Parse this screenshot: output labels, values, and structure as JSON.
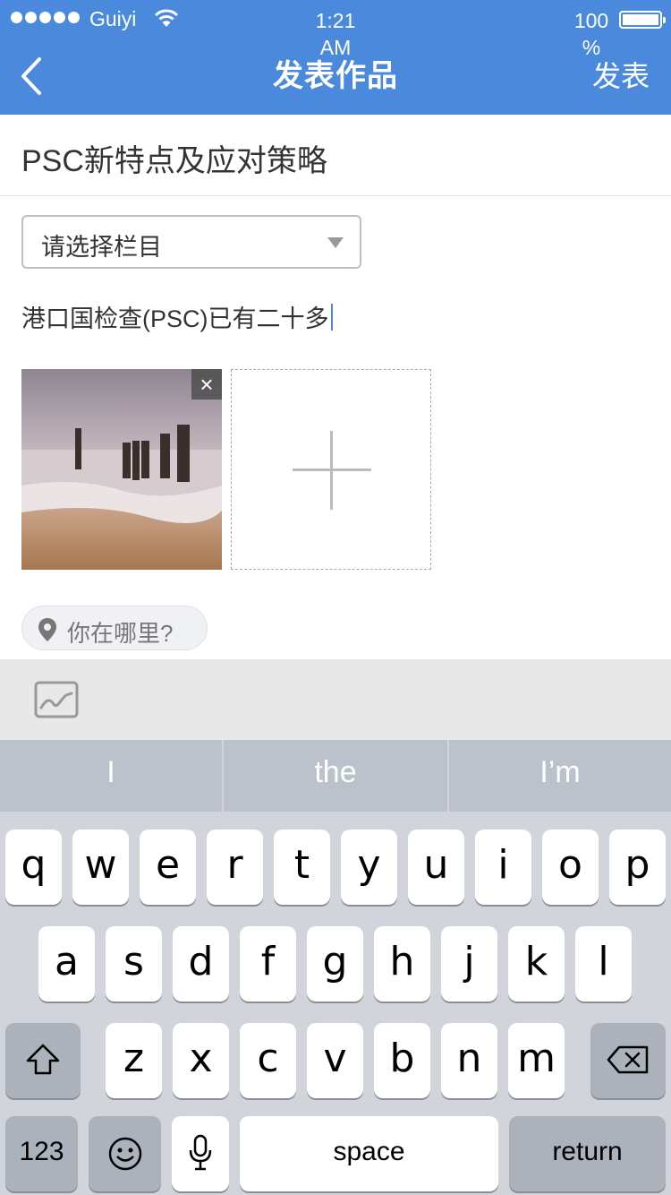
{
  "status_bar": {
    "carrier": "Guiyi",
    "time": "1:21 AM",
    "battery_percent": "100 %"
  },
  "nav": {
    "title": "发表作品",
    "publish_label": "发表"
  },
  "post": {
    "title": "PSC新特点及应对策略",
    "category_placeholder": "请选择栏目",
    "body": "港口国检查(PSC)已有二十多",
    "location_placeholder": "你在哪里?"
  },
  "keyboard": {
    "suggestions": [
      "I",
      "the",
      "I’m"
    ],
    "row1": [
      "q",
      "w",
      "e",
      "r",
      "t",
      "y",
      "u",
      "i",
      "o",
      "p"
    ],
    "row2": [
      "a",
      "s",
      "d",
      "f",
      "g",
      "h",
      "j",
      "k",
      "l"
    ],
    "row3": [
      "z",
      "x",
      "c",
      "v",
      "b",
      "n",
      "m"
    ],
    "numbers_label": "123",
    "space_label": "space",
    "return_label": "return"
  },
  "colors": {
    "header": "#4a89dc",
    "caret": "#4a89dc",
    "keyboard_bg": "#d1d5db"
  }
}
